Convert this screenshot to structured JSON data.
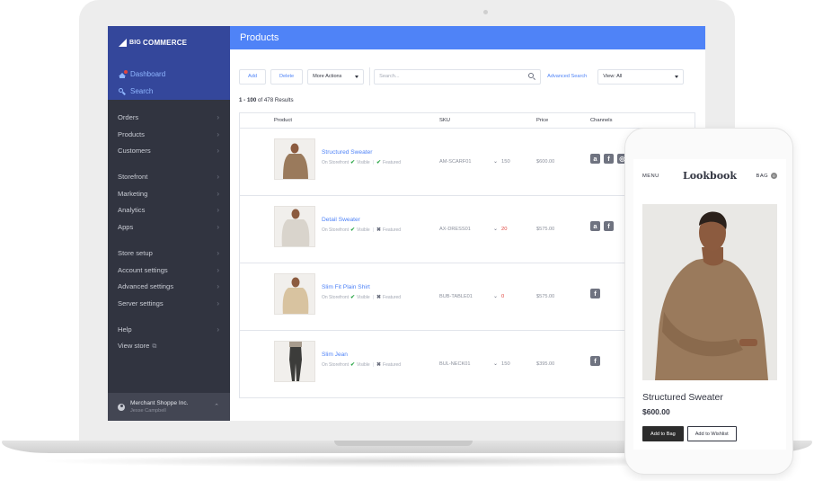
{
  "admin": {
    "brand": {
      "big": "BIG",
      "rest": "COMMERCE"
    },
    "sidebar": {
      "dashboard": "Dashboard",
      "search": "Search",
      "groups": [
        [
          {
            "label": "Orders"
          },
          {
            "label": "Products"
          },
          {
            "label": "Customers"
          }
        ],
        [
          {
            "label": "Storefront"
          },
          {
            "label": "Marketing"
          },
          {
            "label": "Analytics"
          },
          {
            "label": "Apps"
          }
        ],
        [
          {
            "label": "Store setup"
          },
          {
            "label": "Account settings"
          },
          {
            "label": "Advanced settings"
          },
          {
            "label": "Server settings"
          }
        ],
        [
          {
            "label": "Help"
          },
          {
            "label": "View store"
          }
        ]
      ],
      "footer": {
        "name": "Merchant Shoppe Inc.",
        "user": "Jesse Campbell"
      }
    },
    "page_title": "Products",
    "toolbar": {
      "add": "Add",
      "delete": "Delete",
      "more_actions": "More Actions",
      "search_placeholder": "Search...",
      "advanced_search": "Advanced Search",
      "view": "View: All"
    },
    "results": {
      "range": "1 - 100",
      "suffix": " of 478 Results"
    },
    "table": {
      "headers": {
        "product": "Product",
        "sku": "SKU",
        "price": "Price",
        "channels": "Channels"
      },
      "rows": [
        {
          "name": "Structured Sweater",
          "on_storefront": "On Storefront",
          "visible": "Visible",
          "featured": "Featured",
          "featured_on": true,
          "sku": "AM-SCARF01",
          "stock": "150",
          "price": "$600.00",
          "channels": [
            "a",
            "f",
            "i"
          ]
        },
        {
          "name": "Detail Sweater",
          "on_storefront": "On Storefront",
          "visible": "Visible",
          "featured": "Featured",
          "featured_on": false,
          "sku": "AX-DRESS01",
          "stock": "20",
          "price": "$575.00",
          "channels": [
            "a",
            "f"
          ]
        },
        {
          "name": "Slim Fit Plain Shirt",
          "on_storefront": "On Storefront",
          "visible": "Visible",
          "featured": "Featured",
          "featured_on": false,
          "sku": "BUB-TABLE01",
          "stock": "0",
          "price": "$575.00",
          "channels": [
            "f"
          ]
        },
        {
          "name": "Slim Jean",
          "on_storefront": "On Storefront",
          "visible": "Visible",
          "featured": "Featured",
          "featured_on": false,
          "sku": "BUL-NECK01",
          "stock": "150",
          "price": "$395.00",
          "channels": [
            "f"
          ]
        }
      ]
    }
  },
  "mobile": {
    "menu": "MENU",
    "brand": "Lookbook",
    "bag": "BAG",
    "bag_count": "0",
    "product_title": "Structured Sweater",
    "product_price": "$600.00",
    "add_to_bag": "Add to Bag",
    "add_to_wishlist": "Add to Wishlist"
  },
  "colors": {
    "sidebar": "#313440",
    "sidebar_top": "#34479b",
    "header": "#4f83f7",
    "link": "#4f83f7",
    "check": "#2ea74a",
    "low_stock": "#e0463f",
    "sweater": "#9a7a5c"
  },
  "icons": {
    "dashboard": "house-icon",
    "search": "search-icon",
    "channel_a": "amazon-icon",
    "channel_f": "facebook-icon",
    "channel_i": "instagram-icon"
  }
}
